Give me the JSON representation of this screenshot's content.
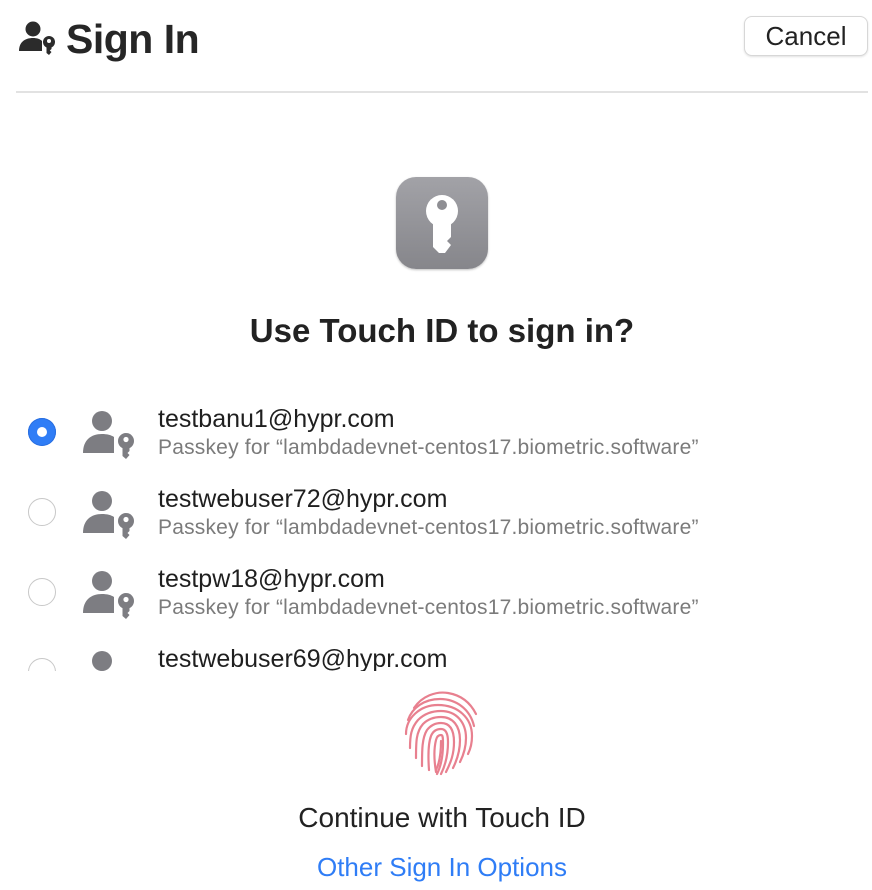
{
  "header": {
    "title": "Sign In",
    "icon": "person-key-icon",
    "cancel_label": "Cancel"
  },
  "main": {
    "app_icon": "key-icon",
    "prompt": "Use Touch ID to sign in?",
    "accounts": [
      {
        "email": "testbanu1@hypr.com",
        "subtitle": "Passkey for “lambdadevnet-centos17.biometric.software”",
        "selected": true
      },
      {
        "email": "testwebuser72@hypr.com",
        "subtitle": "Passkey for “lambdadevnet-centos17.biometric.software”",
        "selected": false
      },
      {
        "email": "testpw18@hypr.com",
        "subtitle": "Passkey for “lambdadevnet-centos17.biometric.software”",
        "selected": false
      },
      {
        "email": "testwebuser69@hypr.com",
        "subtitle": "",
        "selected": false
      }
    ]
  },
  "footer": {
    "fingerprint_icon": "fingerprint-icon",
    "touch_label": "Continue with Touch ID",
    "other_options_label": "Other Sign In Options"
  },
  "colors": {
    "accent": "#2f7df6",
    "icon_gray": "#7d7d82",
    "fingerprint": "#e8808f",
    "secondary_text": "#7b7b7b"
  }
}
